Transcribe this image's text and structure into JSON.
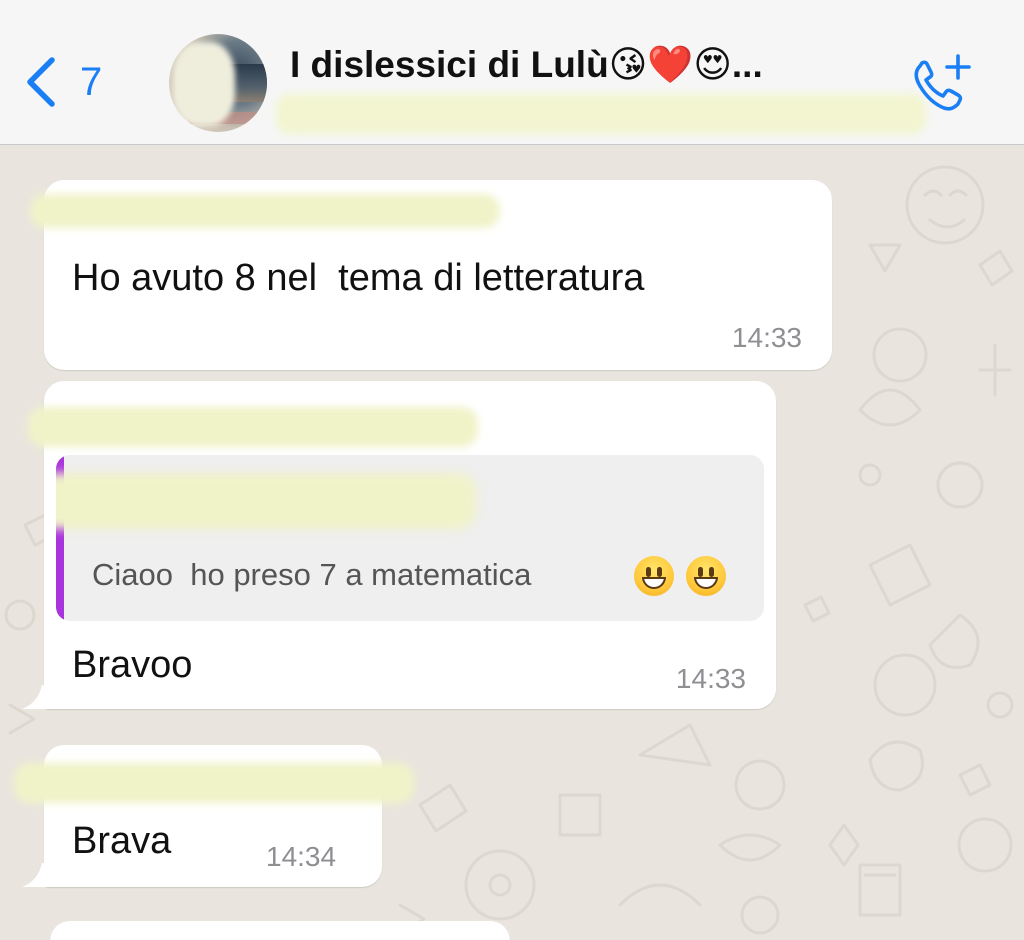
{
  "header": {
    "back_count": "7",
    "chat_title": "I dislessici di Lulù😘❤️😍..."
  },
  "messages": [
    {
      "text": "Ho avuto 8 nel  tema di letteratura",
      "time": "14:33"
    },
    {
      "quote_text": "Ciaoo  ho preso 7 a matematica",
      "text": "Bravoo",
      "time": "14:33"
    },
    {
      "text": "Brava",
      "time": "14:34"
    }
  ],
  "icons": {
    "back": "chevron-left-icon",
    "call": "phone-add-icon",
    "emoji": "grinning-face-icon"
  },
  "colors": {
    "accent": "#1a7ff5",
    "quote_bar": "#a934de",
    "timestamp": "#8e8e93",
    "chat_bg": "#e9e5de"
  }
}
